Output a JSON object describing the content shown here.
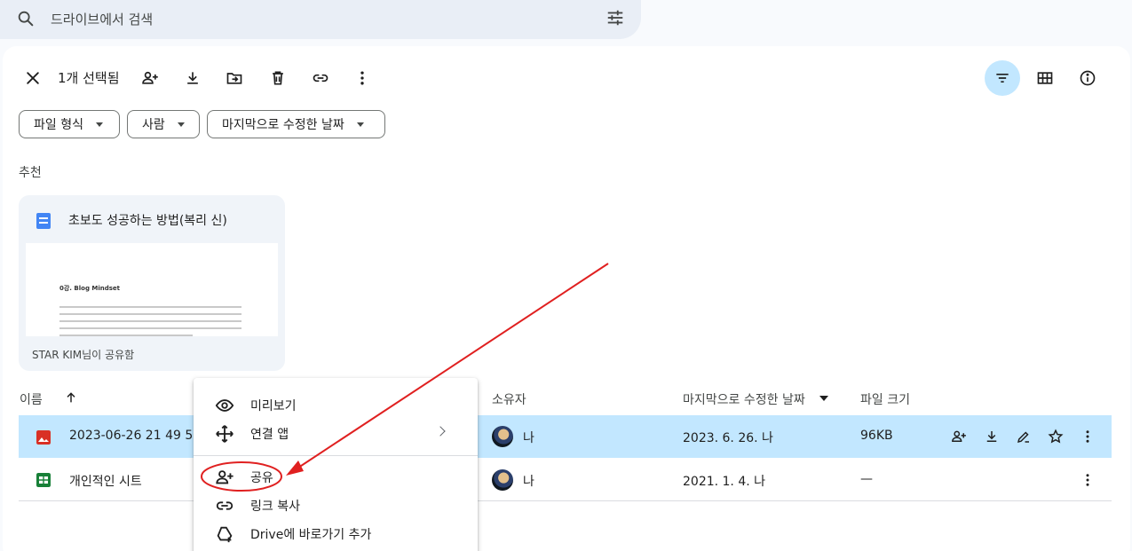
{
  "search": {
    "placeholder": "드라이브에서 검색"
  },
  "toolbar": {
    "selected_count": "1개 선택됨"
  },
  "filters": [
    {
      "label": "파일 형식"
    },
    {
      "label": "사람"
    },
    {
      "label": "마지막으로 수정한 날짜"
    }
  ],
  "suggested": {
    "title": "추천",
    "card": {
      "title": "초보도 성공하는 방법(복리 신)",
      "preview_heading": "0강. Blog Mindset",
      "shared_by": "STAR KIM님이 공유함"
    }
  },
  "table": {
    "headers": {
      "name": "이름",
      "owner": "소유자",
      "modified": "마지막으로 수정한 날짜",
      "size": "파일 크기"
    },
    "rows": [
      {
        "name": "2023-06-26 21 49 50.",
        "owner": "나",
        "modified": "2023. 6. 26. 나",
        "size": "96KB",
        "type": "image"
      },
      {
        "name": "개인적인 시트",
        "owner": "나",
        "modified": "2021. 1. 4. 나",
        "size": "—",
        "type": "sheet"
      }
    ]
  },
  "context_menu": {
    "items": [
      {
        "label": "미리보기",
        "icon": "eye-icon"
      },
      {
        "label": "연결 앱",
        "icon": "open-with-icon"
      },
      {
        "label": "공유",
        "icon": "person-add-icon"
      },
      {
        "label": "링크 복사",
        "icon": "link-icon"
      },
      {
        "label": "Drive에 바로가기 추가",
        "icon": "add-shortcut-icon"
      }
    ]
  },
  "colors": {
    "accent_selected": "#c2e7ff",
    "annotation": "#e02020",
    "doc_blue": "#4285f4",
    "image_red": "#d93025",
    "sheet_green": "#188038"
  }
}
